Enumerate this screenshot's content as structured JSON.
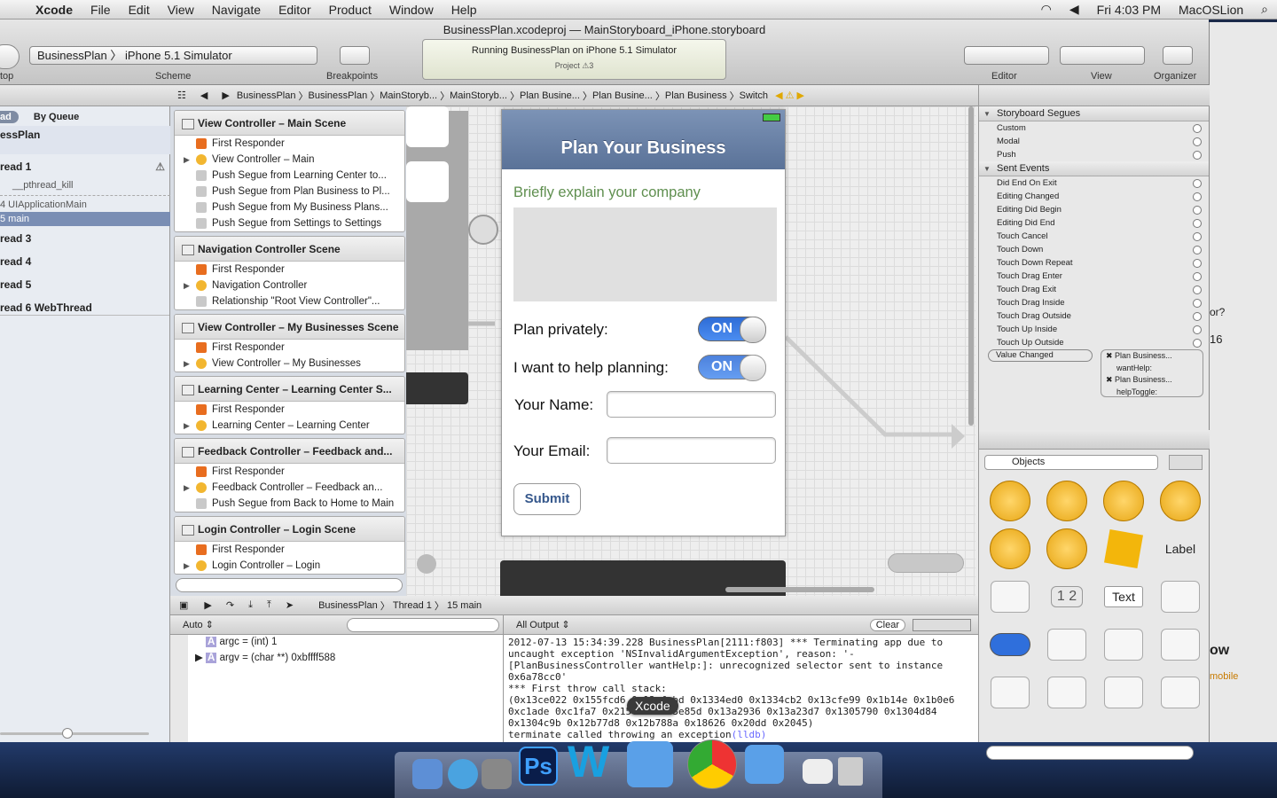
{
  "menubar": {
    "app": "Xcode",
    "items": [
      "File",
      "Edit",
      "View",
      "Navigate",
      "Editor",
      "Product",
      "Window",
      "Help"
    ],
    "clock": "Fri 4:03 PM",
    "user": "MacOSLion"
  },
  "window": {
    "title_project": "BusinessPlan.xcodeproj",
    "title_sep": "—",
    "title_file": "MainStoryboard_iPhone.storyboard"
  },
  "toolbar": {
    "stop_label": "top",
    "scheme": "BusinessPlan",
    "destination": "iPhone 5.1 Simulator",
    "scheme_label": "Scheme",
    "breakpoints_label": "Breakpoints",
    "activity_status": "Running BusinessPlan on iPhone 5.1 Simulator",
    "activity_project": "Project",
    "activity_count": "3",
    "editor_label": "Editor",
    "view_label": "View",
    "organizer_label": "Organizer"
  },
  "navigator": {
    "tab_thread": "ad",
    "tab_queue": "By Queue",
    "process": "essPlan",
    "rows": [
      {
        "label": "read 1",
        "bold": true,
        "warn": true
      },
      {
        "label": "__pthread_kill",
        "bold": false
      },
      {
        "label": "4 UIApplicationMain",
        "bold": false
      },
      {
        "label": "5 main",
        "bold": false,
        "selected": true
      },
      {
        "label": "read 3",
        "bold": true
      },
      {
        "label": "read 4",
        "bold": true
      },
      {
        "label": "read 5",
        "bold": true
      },
      {
        "label": "read 6 WebThread",
        "bold": true
      }
    ]
  },
  "jumpbar": [
    "BusinessPlan",
    "BusinessPlan",
    "MainStoryb...",
    "MainStoryb...",
    "Plan Busine...",
    "Plan Busine...",
    "Plan Business",
    "Switch"
  ],
  "outline": [
    {
      "title": "View Controller – Main Scene",
      "items": [
        "First Responder",
        "View Controller – Main",
        "Push Segue from Learning Center to...",
        "Push Segue from Plan Business to Pl...",
        "Push Segue from My Business Plans...",
        "Push Segue from Settings to Settings"
      ]
    },
    {
      "title": "Navigation Controller Scene",
      "items": [
        "First Responder",
        "Navigation Controller",
        "Relationship \"Root View Controller\"..."
      ]
    },
    {
      "title": "View Controller – My Businesses Scene",
      "items": [
        "First Responder",
        "View Controller – My Businesses"
      ]
    },
    {
      "title": "Learning Center – Learning Center S...",
      "items": [
        "First Responder",
        "Learning Center – Learning Center"
      ]
    },
    {
      "title": "Feedback Controller – Feedback and...",
      "items": [
        "First Responder",
        "Feedback Controller – Feedback an...",
        "Push Segue from Back to Home to Main"
      ]
    },
    {
      "title": "Login Controller – Login Scene",
      "items": [
        "First Responder",
        "Login Controller – Login"
      ]
    }
  ],
  "phone": {
    "nav_title": "Plan Your Business",
    "prompt": "Briefly explain your company",
    "plan_privately": "Plan privately:",
    "help_planning": "I want to help planning:",
    "switch_on": "ON",
    "name_label": "Your Name:",
    "email_label": "Your Email:",
    "submit": "Submit"
  },
  "debugbar": {
    "crumbs": [
      "BusinessPlan",
      "Thread 1",
      "15 main"
    ]
  },
  "variables": {
    "scope": "Auto ⇕",
    "rows": [
      "argc = (int) 1",
      "argv = (char **) 0xbffff588"
    ]
  },
  "console": {
    "filter": "All Output ⇕",
    "clear": "Clear",
    "text": "2012-07-13 15:34:39.228 BusinessPlan[2111:f803] *** Terminating app due to uncaught exception 'NSInvalidArgumentException', reason: '-[PlanBusinessController wantHelp:]: unrecognized selector sent to instance 0x6a78cc0'\n*** First throw call stack:\n(0x13ce022 0x155fcd6 0x13cfcbd 0x1334ed0 0x1334cb2 0x13cfe99 0x1b14e 0x1b0e6 0xc1ade 0xc1fa7 0x215c16 0x93e85d 0x13a2936 0x13a23d7 0x1305790 0x1304d84 0x1304c9b 0x12b77d8 0x12b788a 0x18626 0x20dd 0x2045)\nterminate called throwing an exception",
    "prompt": "(lldb)",
    "dock_tooltip": "Xcode"
  },
  "connections": {
    "segues_title": "Storyboard Segues",
    "segues": [
      "Custom",
      "Modal",
      "Push"
    ],
    "events_title": "Sent Events",
    "events": [
      "Did End On Exit",
      "Editing Changed",
      "Editing Did Begin",
      "Editing Did End",
      "Touch Cancel",
      "Touch Down",
      "Touch Down Repeat",
      "Touch Drag Enter",
      "Touch Drag Exit",
      "Touch Drag Inside",
      "Touch Drag Outside",
      "Touch Up Inside",
      "Touch Up Outside"
    ],
    "value_changed": "Value Changed",
    "targets": [
      "Plan Business...",
      "wantHelp:",
      "Plan Business...",
      "helpToggle:"
    ]
  },
  "library": {
    "selector": "Objects",
    "label_item": "Label",
    "text_item": "Text",
    "stepper": "1 2"
  },
  "backwin": {
    "frag1": "or?",
    "frag2": "16",
    "frag3": "ow",
    "frag4": "mobile"
  },
  "colors": {
    "accent": "#3b7be8",
    "navbar": "#6d84a9",
    "prompt": "#5f8f4f",
    "console_prompt": "#6a6aff"
  }
}
